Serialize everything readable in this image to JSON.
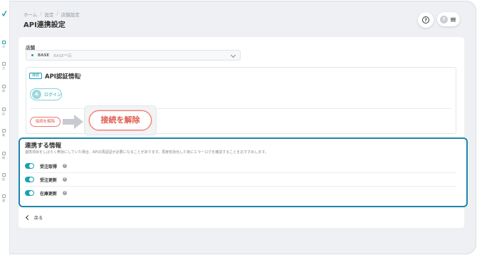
{
  "breadcrumb": [
    "ホーム",
    "設定",
    "店舗設定"
  ],
  "breadcrumb_sep": "/",
  "page_title": "API連携設定",
  "header": {
    "avatar_initial": "T"
  },
  "store": {
    "label": "店舗",
    "badge": "BASE",
    "value": "BASE**店"
  },
  "auth": {
    "status_badge": "接続",
    "title": "API認証情報",
    "login_logo": "A",
    "login_label": "ログイン",
    "disconnect_label": "接続を解除",
    "disconnect_zoom_label": "接続を解除"
  },
  "linked": {
    "title": "連携する情報",
    "description": "連携項目をしばらく無効にしていた場合、APIの再認証が必要になることがあります。再度有効化した後にエラーログを確認することをおすすめします。",
    "items": [
      {
        "label": "受注取得",
        "enabled": true
      },
      {
        "label": "受注更新",
        "enabled": true
      },
      {
        "label": "在庫更新",
        "enabled": true
      }
    ]
  },
  "back_label": "戻る",
  "colors": {
    "accent": "#1a9cb0",
    "danger": "#e05a4f",
    "highlight_border": "#1a87ad"
  },
  "sidebar": {
    "items": [
      {
        "icon": "home-icon",
        "label": "ホ"
      },
      {
        "icon": "list-icon",
        "label": "注"
      },
      {
        "icon": "box-icon",
        "label": "商"
      },
      {
        "icon": "store-icon",
        "label": "店"
      },
      {
        "icon": "chart-icon",
        "label": "集"
      },
      {
        "icon": "doc-icon",
        "label": "帳"
      },
      {
        "icon": "gear-icon",
        "label": "設"
      },
      {
        "icon": "bell-icon",
        "label": "通"
      }
    ]
  }
}
